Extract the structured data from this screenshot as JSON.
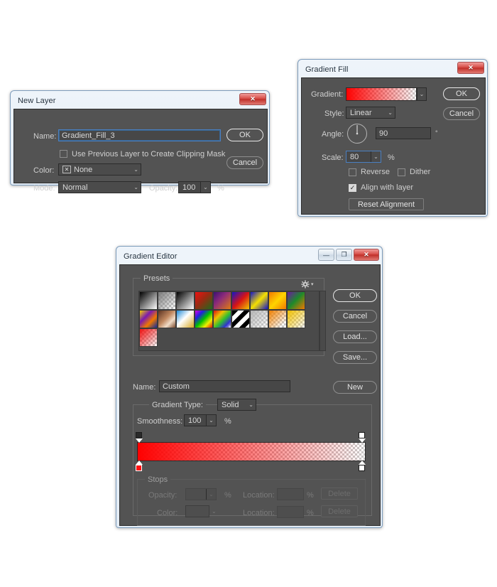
{
  "colors": {
    "panel_bg": "#535353",
    "field_bg": "#474747",
    "focus_blue": "#4a7fc1",
    "gradient_start": "#ff0000",
    "gradient_end": "#ffffff",
    "close_red": "#c0302a"
  },
  "new_layer": {
    "title": "New Layer",
    "close_glyph": "✕",
    "name_label": "Name:",
    "name_value": "Gradient_Fill_3",
    "clipping_checkbox_label": "Use Previous Layer to Create Clipping Mask",
    "clipping_checked": false,
    "color_label": "Color:",
    "color_value": "None",
    "color_none_glyph": "✕",
    "mode_label": "Mode:",
    "mode_value": "Normal",
    "opacity_label": "Opacity:",
    "opacity_value": "100",
    "opacity_unit": "%",
    "ok_label": "OK",
    "cancel_label": "Cancel",
    "caret_glyph": "⌄"
  },
  "gradient_fill": {
    "title": "Gradient Fill",
    "close_glyph": "✕",
    "gradient_label": "Gradient:",
    "style_label": "Style:",
    "style_value": "Linear",
    "angle_label": "Angle:",
    "angle_value": "90",
    "angle_unit": "°",
    "scale_label": "Scale:",
    "scale_value": "80",
    "scale_unit": "%",
    "reverse_label": "Reverse",
    "reverse_checked": false,
    "dither_label": "Dither",
    "dither_checked": false,
    "align_label": "Align with layer",
    "align_checked": true,
    "align_check_glyph": "✓",
    "reset_alignment_label": "Reset Alignment",
    "ok_label": "OK",
    "cancel_label": "Cancel",
    "caret_glyph": "⌄"
  },
  "gradient_editor": {
    "title": "Gradient Editor",
    "minimize_glyph": "—",
    "maximize_glyph": "❐",
    "close_glyph": "✕",
    "presets_label": "Presets",
    "presets_menu_icon": "gear-icon",
    "ok_label": "OK",
    "cancel_label": "Cancel",
    "load_label": "Load...",
    "save_label": "Save...",
    "new_label": "New",
    "name_label": "Name:",
    "name_value": "Custom",
    "gradient_type_label": "Gradient Type:",
    "gradient_type_value": "Solid",
    "smoothness_label": "Smoothness:",
    "smoothness_value": "100",
    "smoothness_unit": "%",
    "stops_label": "Stops",
    "opacity_label": "Opacity:",
    "opacity_value": "",
    "opacity_unit": "%",
    "color_label": "Color:",
    "location_label_1": "Location:",
    "location_value_1": "",
    "location_unit_1": "%",
    "location_label_2": "Location:",
    "location_value_2": "",
    "location_unit_2": "%",
    "delete_label_1": "Delete",
    "delete_label_2": "Delete",
    "caret_glyph": "⌄",
    "presets": [
      {
        "name": "foreground-to-background",
        "css": "linear-gradient(135deg,#000000 0%,#ffffff 100%)",
        "checker": false
      },
      {
        "name": "foreground-to-transparent",
        "css": "linear-gradient(135deg,#7a7a7a 0%,rgba(255,255,255,0) 100%)",
        "checker": true
      },
      {
        "name": "black-white",
        "css": "linear-gradient(135deg,#000000 0%,#ffffff 100%)",
        "checker": false
      },
      {
        "name": "red-green",
        "css": "linear-gradient(135deg,#ee1111 0%,#9a2a12 45%,#1d6b1d 100%)",
        "checker": false
      },
      {
        "name": "violet-orange",
        "css": "linear-gradient(135deg,#3a1173 0%,#8c2b7a 40%,#e07b12 100%)",
        "checker": false
      },
      {
        "name": "blue-red-yellow",
        "css": "linear-gradient(135deg,#1414c8 0%,#d81414 50%,#f0c800 100%)",
        "checker": false
      },
      {
        "name": "blue-yellow-blue",
        "css": "linear-gradient(135deg,#1414c8 0%,#f5e000 50%,#1414c8 100%)",
        "checker": false
      },
      {
        "name": "orange-yellow-orange",
        "css": "linear-gradient(135deg,#f07800 0%,#ffd400 50%,#f07800 100%)",
        "checker": false
      },
      {
        "name": "violet-green-orange",
        "css": "linear-gradient(135deg,#6b1aa0 0%,#1d8a2a 48%,#f07800 100%)",
        "checker": false
      },
      {
        "name": "yellow-violet-orange-blue",
        "css": "linear-gradient(135deg,#f0d000 0%,#7a1ab0 35%,#f07800 65%,#102a9e 100%)",
        "checker": false
      },
      {
        "name": "copper",
        "css": "linear-gradient(135deg,#5a3320 0%,#c08860 45%,#f0dcc8 70%,#7a4a2c 100%)",
        "checker": false
      },
      {
        "name": "chrome",
        "css": "linear-gradient(135deg,#1f8ad6 0%,#ffffff 45%,#d8a820 100%)",
        "checker": false
      },
      {
        "name": "spectrum",
        "css": "linear-gradient(135deg,#e000e0 0%,#2020e0 25%,#00c000 50%,#f0f000 75%,#e01010 100%)",
        "checker": false
      },
      {
        "name": "transparent-rainbow",
        "css": "linear-gradient(135deg,#e01010 0%,#f0c000 30%,#30c030 55%,#3030d0 80%,rgba(255,255,255,0) 100%)",
        "checker": true
      },
      {
        "name": "transparent-stripes",
        "css": "repeating-linear-gradient(135deg,#000000 0 6px,#ffffff 6px 12px)",
        "checker": false
      },
      {
        "name": "neutral-density",
        "css": "linear-gradient(135deg,#b4b4b4 0%,rgba(255,255,255,0) 100%)",
        "checker": true
      },
      {
        "name": "orange-transparent",
        "css": "linear-gradient(135deg,#f08000 0%,rgba(255,255,255,0) 85%)",
        "checker": true
      },
      {
        "name": "yellow-transparent",
        "css": "linear-gradient(135deg,#f0c000 0%,rgba(255,255,255,0) 100%)",
        "checker": true
      },
      {
        "name": "red-transparent",
        "css": "linear-gradient(135deg,#f01010 0%,rgba(255,255,255,0) 100%)",
        "checker": true
      }
    ]
  }
}
